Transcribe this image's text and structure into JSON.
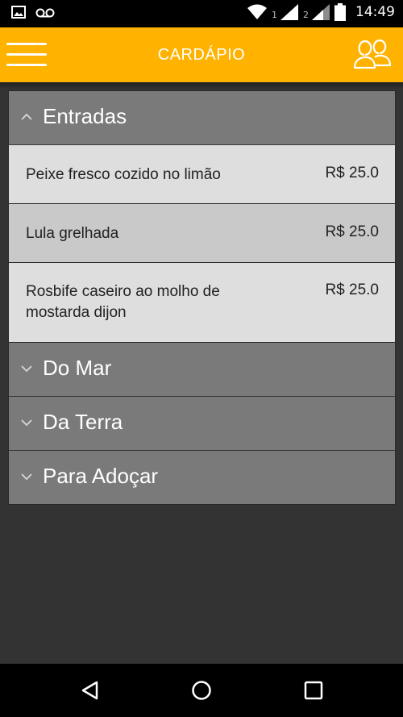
{
  "status_bar": {
    "sim1": "1",
    "sim2": "2",
    "time": "14:49",
    "icons": [
      "image-icon",
      "voicemail-icon",
      "wifi-icon",
      "signal-icon",
      "battery-icon"
    ]
  },
  "app_bar": {
    "title": "CARDÁPIO",
    "background": "#FFB300",
    "icons": [
      "hamburger-menu-icon",
      "users-icon"
    ]
  },
  "menu": {
    "groups": [
      {
        "label": "Entradas",
        "expanded": true,
        "items": [
          {
            "name": "Peixe fresco cozido no limão",
            "price": "R$ 25.0"
          },
          {
            "name": "Lula grelhada",
            "price": "R$ 25.0"
          },
          {
            "name": "Rosbife caseiro ao molho de mostarda dijon",
            "price": "R$ 25.0"
          }
        ]
      },
      {
        "label": "Do Mar",
        "expanded": false
      },
      {
        "label": "Da Terra",
        "expanded": false
      },
      {
        "label": "Para Adoçar",
        "expanded": false
      }
    ]
  },
  "nav_bar": {
    "icons": [
      "back-icon",
      "home-icon",
      "recents-icon"
    ]
  }
}
